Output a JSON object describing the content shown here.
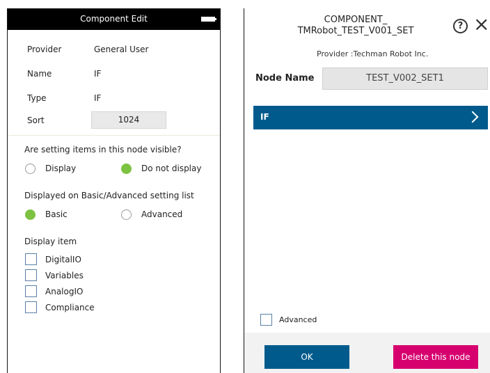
{
  "left_panel": {
    "title": "Component Edit",
    "fields": {
      "provider_label": "Provider",
      "provider_value": "General User",
      "name_label": "Name",
      "name_value": "IF",
      "type_label": "Type",
      "type_value": "IF",
      "sort_label": "Sort",
      "sort_value": "1024"
    },
    "visibility": {
      "question": "Are setting items in this node visible?",
      "option_display": "Display",
      "option_do_not_display": "Do not display",
      "selected": "Do not display"
    },
    "list_type": {
      "question": "Displayed on Basic/Advanced setting list",
      "option_basic": "Basic",
      "option_advanced": "Advanced",
      "selected": "Basic"
    },
    "display_item": {
      "heading": "Display item",
      "items": [
        "DigitalIO",
        "Variables",
        "AnalogIO",
        "Compliance"
      ]
    }
  },
  "right_panel": {
    "title_line1": "COMPONENT_",
    "title_line2": "TMRobot_TEST_V001_SET",
    "help_icon": "?",
    "close_icon": "×",
    "provider": "Provider :Techman Robot Inc.",
    "node_name_label": "Node Name",
    "node_name_value": "TEST_V002_SET1",
    "list_item": "IF",
    "advanced_label": "Advanced",
    "ok_button": "OK",
    "delete_button": "Delete this node"
  },
  "colors": {
    "accent_blue": "#005b8c",
    "radio_selected": "#7dc241",
    "delete_pink": "#d6006f"
  }
}
